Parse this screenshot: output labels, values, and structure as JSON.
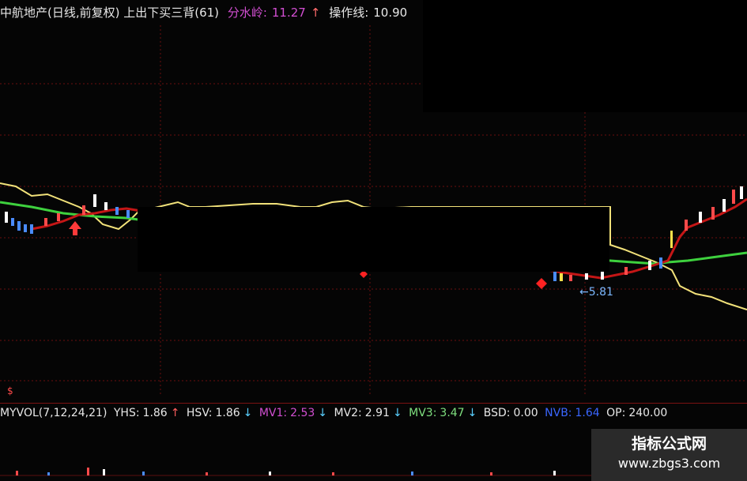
{
  "header": {
    "title": "中航地产(日线,前复权) 上出下买三背(61)",
    "fsl_label": "分水岭:",
    "fsl_value": "11.27",
    "fsl_arrow": "↑",
    "czx_label": "操作线:",
    "czx_value": "10.90"
  },
  "chart_marks": {
    "price_label": "←5.81",
    "dollar_marker": "$"
  },
  "volume_bar": {
    "name": "MYVOL(7,12,24,21)",
    "yhs_label": "YHS:",
    "yhs_value": "1.86",
    "yhs_arrow": "↑",
    "hsv_label": "HSV:",
    "hsv_value": "1.86",
    "hsv_arrow": "↓",
    "mv1_label": "MV1:",
    "mv1_value": "2.53",
    "mv1_arrow": "↓",
    "mv2_label": "MV2:",
    "mv2_value": "2.91",
    "mv2_arrow": "↓",
    "mv3_label": "MV3:",
    "mv3_value": "3.47",
    "mv3_arrow": "↓",
    "bsd_label": "BSD:",
    "bsd_value": "0.00",
    "nvb_label": "NVB:",
    "nvb_value": "1.64",
    "op_label": "OP:",
    "op_value": "240.00"
  },
  "watermark": {
    "title": "指标公式网",
    "url": "www.zbgs3.com"
  },
  "colors": {
    "background": "#050505",
    "grid": "#6a1010",
    "yellow_line": "#f2e27a",
    "green_line": "#3ed13e",
    "red_line": "#c41616",
    "blue_candle": "#4a8cff"
  }
}
